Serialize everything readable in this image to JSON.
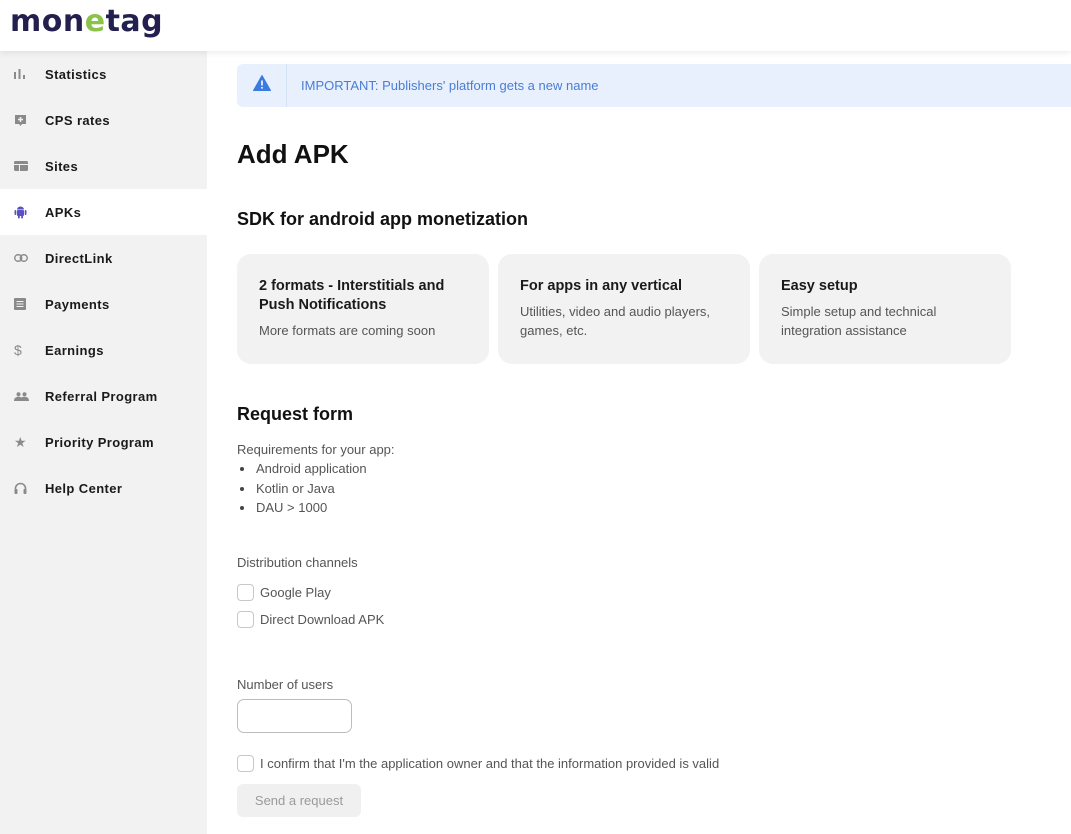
{
  "header": {
    "logo_pre": "mon",
    "logo_e": "e",
    "logo_post": "tag"
  },
  "sidebar": {
    "items": [
      {
        "label": "Statistics",
        "icon": "bar-chart-icon",
        "active": false
      },
      {
        "label": "CPS rates",
        "icon": "plus-box-icon",
        "active": false
      },
      {
        "label": "Sites",
        "icon": "browser-window-icon",
        "active": false
      },
      {
        "label": "APKs",
        "icon": "android-icon",
        "active": true
      },
      {
        "label": "DirectLink",
        "icon": "link-icon",
        "active": false
      },
      {
        "label": "Payments",
        "icon": "document-list-icon",
        "active": false
      },
      {
        "label": "Earnings",
        "icon": "dollar-icon",
        "active": false
      },
      {
        "label": "Referral Program",
        "icon": "people-icon",
        "active": false
      },
      {
        "label": "Priority Program",
        "icon": "star-icon",
        "active": false
      },
      {
        "label": "Help Center",
        "icon": "headset-icon",
        "active": false
      }
    ]
  },
  "notice": {
    "icon": "warning-icon",
    "text": "IMPORTANT: Publishers' platform gets a new name",
    "bg_color": "#e7f0fc",
    "text_color": "#4a7dd4"
  },
  "page": {
    "title": "Add APK",
    "section_title": "SDK for android app monetization"
  },
  "cards": [
    {
      "title": "2 formats - Interstitials and Push Notifications",
      "text": "More formats are coming soon"
    },
    {
      "title": "For apps in any vertical",
      "text": "Utilities, video and audio players, games, etc."
    },
    {
      "title": "Easy setup",
      "text": "Simple setup and technical integration assistance"
    }
  ],
  "form": {
    "title": "Request form",
    "requirements_label": "Requirements for your app:",
    "requirements": [
      "Android application",
      "Kotlin or Java",
      "DAU > 1000"
    ],
    "distribution_label": "Distribution channels",
    "channels": [
      {
        "label": "Google Play",
        "checked": false
      },
      {
        "label": "Direct Download APK",
        "checked": false
      }
    ],
    "users_label": "Number of users",
    "users_value": "",
    "confirm_label": "I confirm that I'm the application owner and that the information provided is valid",
    "confirm_checked": false,
    "submit_label": "Send a request"
  },
  "colors": {
    "accent": "#5b4fc4",
    "logo_dark": "#231f4f",
    "logo_green": "#8bc34a"
  }
}
